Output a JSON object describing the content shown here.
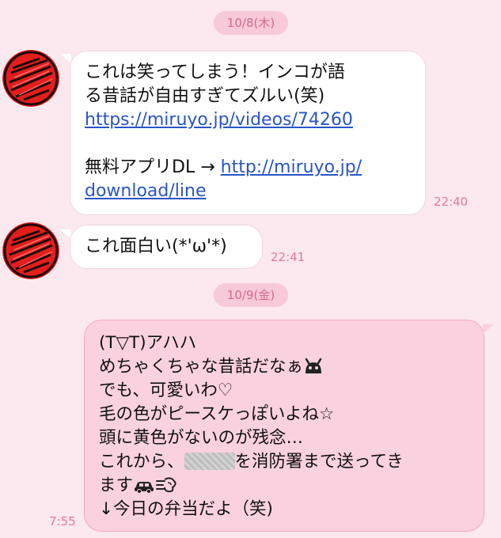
{
  "dates": {
    "first": "10/8(木)",
    "second": "10/9(金)"
  },
  "messages": {
    "m1": {
      "line1": "これは笑ってしまう！インコが語",
      "line2": "る昔話が自由すぎてズルい(笑)",
      "link1": "https://miruyo.jp/videos/74260",
      "line4_prefix": "無料アプリDL → ",
      "link2a": "http://miruyo.jp/",
      "link2b": "download/line",
      "time": "22:40"
    },
    "m2": {
      "text": "これ面白い(*'ω'*)",
      "time": "22:41"
    },
    "m3": {
      "line1": "(T▽T)アハハ",
      "line2": "めちゃくちゃな昔話だなぁ",
      "line3": "でも、可愛いわ♡",
      "line4": "毛の色がピースケっぽいよね☆",
      "line5": "頭に黄色がないのが残念…",
      "line6_prefix": "これから、",
      "line6_suffix": "を消防署まで送ってき",
      "line7": "ます",
      "line8": "↓今日の弁当だよ（笑)",
      "time": "7:55"
    }
  },
  "icons": {
    "avatar": "red-scribble-avatar-icon",
    "emoji1": "android-face-emoji-icon",
    "emoji2": "car-emoji-icon",
    "emoji3": "dash-emoji-icon"
  },
  "colors": {
    "background": "#fce8ef",
    "incoming_bubble": "#ffffff",
    "outgoing_bubble": "#fad1df",
    "date_pill": "#f8c9d8",
    "accent_text": "#e07a98",
    "link": "#2a55c9"
  }
}
